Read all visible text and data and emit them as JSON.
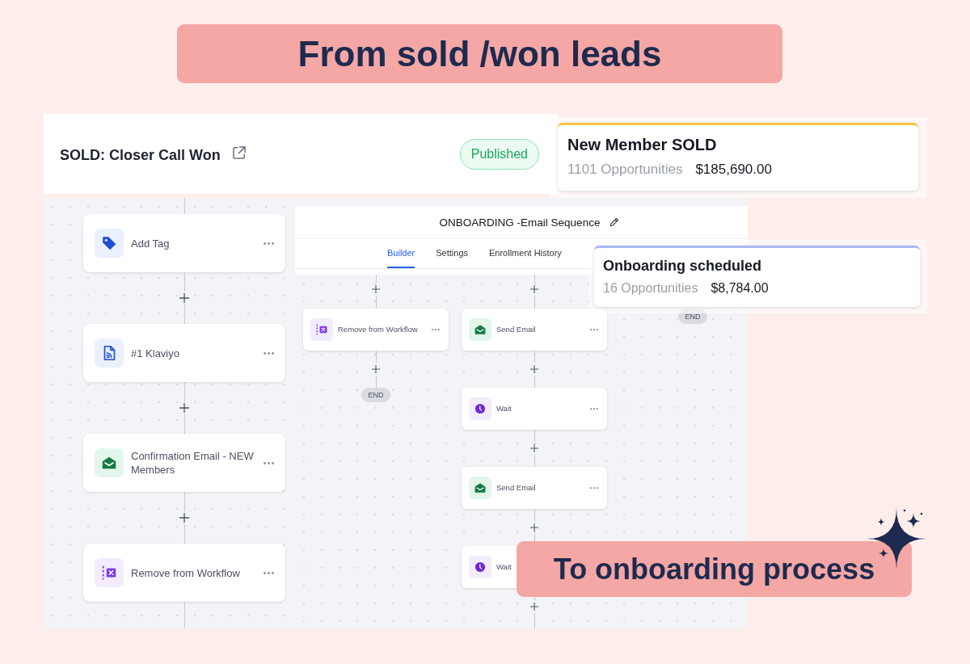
{
  "headline": "From sold /won leads",
  "workflow": {
    "title": "SOLD: Closer Call Won",
    "status": "Published",
    "steps": [
      {
        "kind": "tag",
        "label": "Add Tag"
      },
      {
        "kind": "webhook",
        "label": "#1 Klaviyo"
      },
      {
        "kind": "email",
        "label": "Confirmation Email - NEW Members"
      },
      {
        "kind": "remove",
        "label": "Remove from Workflow"
      }
    ]
  },
  "sequence": {
    "title": "ONBOARDING -Email Sequence",
    "tabs": [
      {
        "label": "Builder",
        "selected": true
      },
      {
        "label": "Settings",
        "selected": false
      },
      {
        "label": "Enrollment History",
        "selected": false
      }
    ],
    "branches": [
      {
        "steps": [
          {
            "kind": "remove",
            "label": "Remove from Workflow"
          }
        ],
        "end": "END"
      },
      {
        "steps": [
          {
            "kind": "email",
            "label": "Send Email"
          },
          {
            "kind": "wait",
            "label": "Wait"
          },
          {
            "kind": "email",
            "label": "Send Email"
          },
          {
            "kind": "wait",
            "label": "Wait"
          }
        ]
      },
      {
        "end": "END"
      }
    ]
  },
  "pipeline_stages": [
    {
      "title": "New Member SOLD",
      "count": "1101 Opportunities",
      "amount": "$185,690.00",
      "color": "#f6c445"
    },
    {
      "title": "Onboarding scheduled",
      "count": "16 Opportunities",
      "amount": "$8,784.00",
      "color": "#a9b8f5"
    }
  ],
  "caption": "To onboarding process"
}
